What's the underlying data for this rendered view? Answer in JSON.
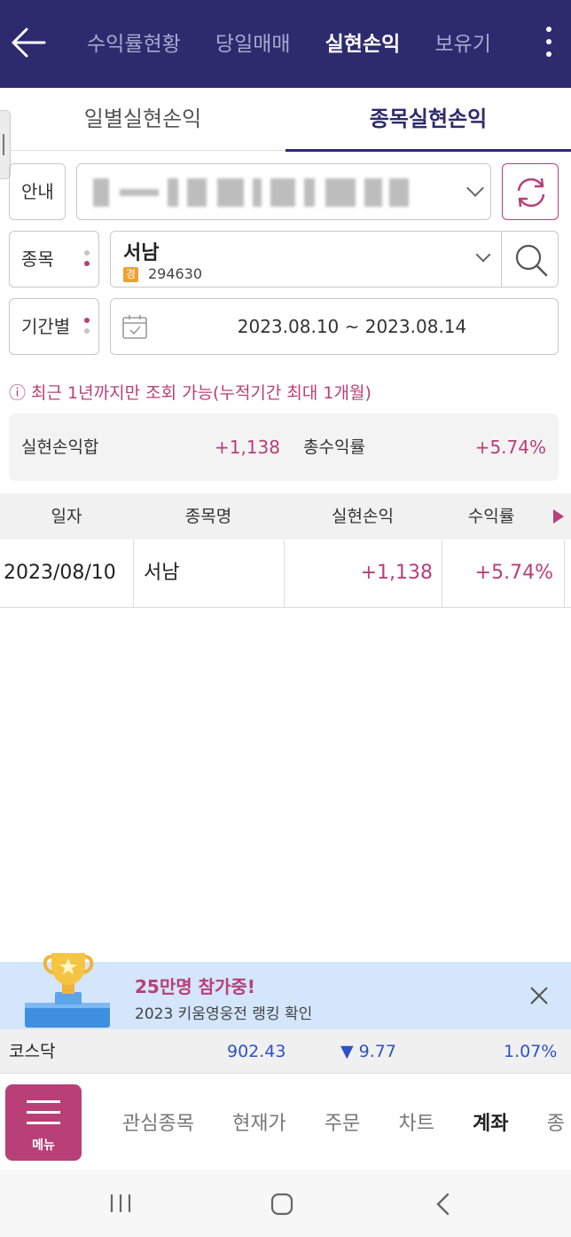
{
  "header": {
    "tabs": [
      "수익률현황",
      "당일매매",
      "실현손익",
      "보유기"
    ],
    "active_tab_index": 2
  },
  "subtabs": {
    "left": "일별실현손익",
    "right": "종목실현손익"
  },
  "form": {
    "account_label": "안내",
    "stock_label": "종목",
    "period_label": "기간별",
    "stock_name": "서남",
    "market_badge": "경",
    "stock_code": "294630",
    "date_range": "2023.08.10 ~ 2023.08.14"
  },
  "notice": "ⓘ 최근 1년까지만 조회 가능(누적기간 최대 1개월)",
  "summary": {
    "realized_label": "실현손익합",
    "realized_value": "+1,138",
    "return_label": "총수익률",
    "return_value": "+5.74%"
  },
  "table": {
    "headers": [
      "일자",
      "종목명",
      "실현손익",
      "수익률"
    ],
    "rows": [
      {
        "date": "2023/08/10",
        "name": "서남",
        "pnl": "+1,138",
        "rate": "+5.74%"
      }
    ]
  },
  "banner": {
    "title": "25만명 참가중!",
    "subtitle": "2023 키움영웅전 랭킹 확인"
  },
  "ticker": {
    "name": "코스닥",
    "value": "902.43",
    "change": "▼ 9.77",
    "rate": "1.07%"
  },
  "bottom_nav": {
    "menu_label": "메뉴",
    "items": [
      "관심종목",
      "현재가",
      "주문",
      "차트",
      "계좌",
      "종"
    ],
    "active_index": 4
  },
  "colors": {
    "header_bg": "#2d2a6e",
    "accent": "#b93f77",
    "down_blue": "#2f52c4",
    "banner_bg": "#d3e6fb"
  }
}
